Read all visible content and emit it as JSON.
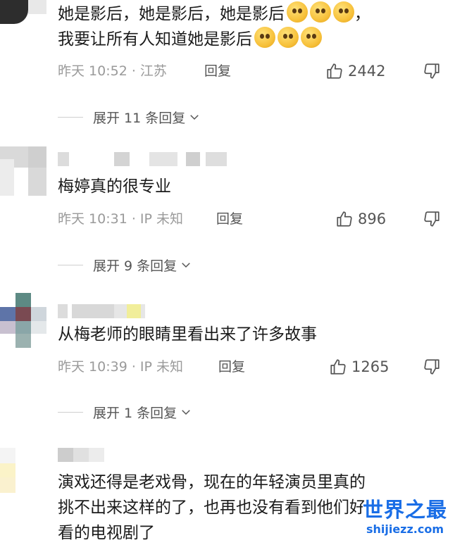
{
  "comments": [
    {
      "lines": [
        "她是影后，她是影后，她是影后",
        "我要让所有人知道她是影后"
      ],
      "line1_suffix": "，",
      "emoji_name": "pleading-face-emoji",
      "meta": "昨天 10:52 · 江苏",
      "reply_label": "回复",
      "likes": "2442",
      "expand_label": "展开 11 条回复"
    },
    {
      "lines": [
        "梅婷真的很专业"
      ],
      "meta": "昨天 10:31 · IP 未知",
      "reply_label": "回复",
      "likes": "896",
      "expand_label": "展开 9 条回复"
    },
    {
      "lines": [
        "从梅老师的眼睛里看出来了许多故事"
      ],
      "meta": "昨天 10:39 · IP 未知",
      "reply_label": "回复",
      "likes": "1265",
      "expand_label": "展开 1 条回复"
    },
    {
      "lines": [
        "演戏还得是老戏骨，现在的年轻演员里真的",
        "挑不出来这样的了，也再也没有看到他们好",
        "看的电视剧了"
      ]
    }
  ],
  "watermark": {
    "title": "世界之最",
    "url": "shijiezz.com"
  },
  "colors": {
    "text": "#1b1b1b",
    "meta": "#9a9a9a",
    "watermark": "#1a6ee6"
  }
}
